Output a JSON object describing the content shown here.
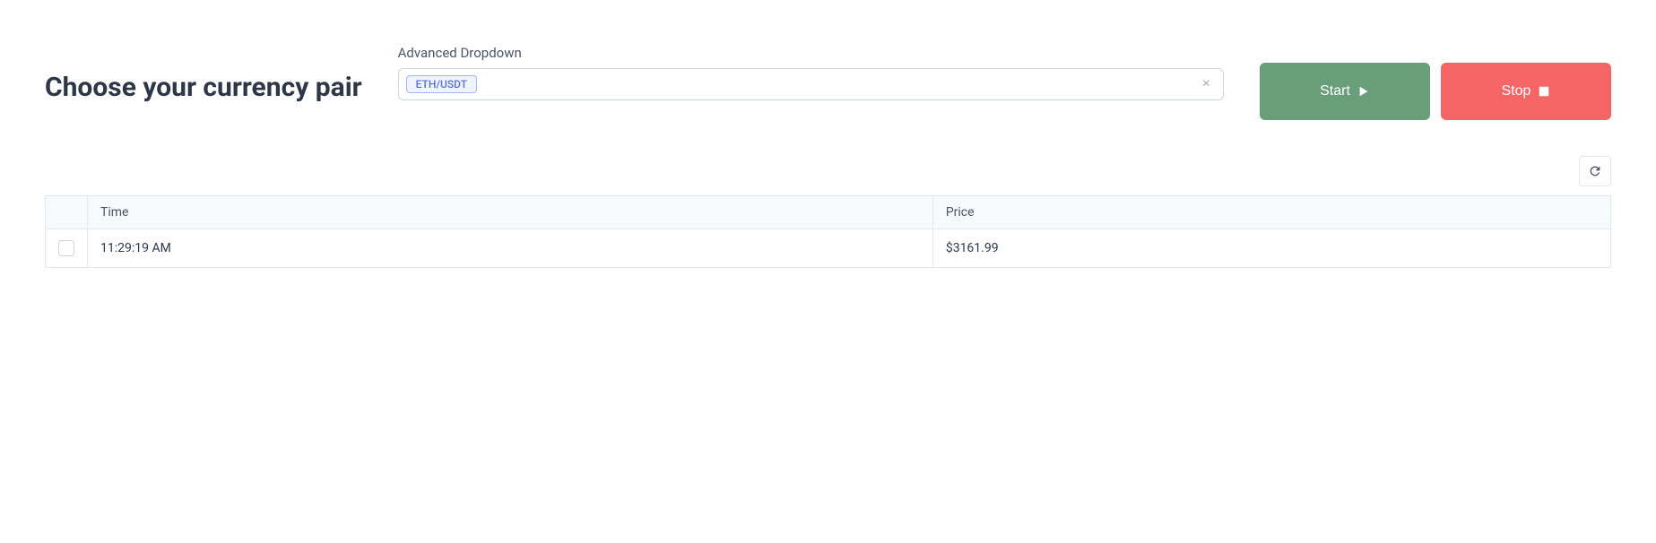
{
  "header": {
    "title": "Choose your currency pair"
  },
  "dropdown": {
    "label": "Advanced Dropdown",
    "selected_tag": "ETH/USDT"
  },
  "buttons": {
    "start_label": "Start",
    "stop_label": "Stop"
  },
  "table": {
    "columns": {
      "time": "Time",
      "price": "Price"
    },
    "rows": [
      {
        "time": "11:29:19 AM",
        "price": "$3161.99"
      }
    ]
  }
}
